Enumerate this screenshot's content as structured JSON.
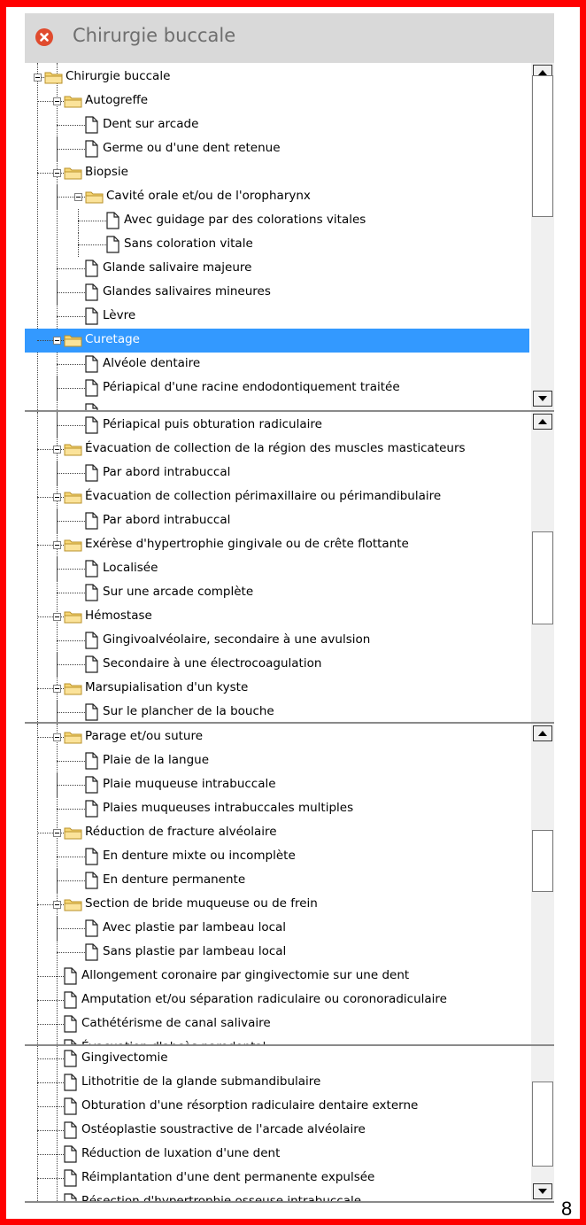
{
  "window": {
    "title": "Chirurgie buccale",
    "close_icon": "close-icon"
  },
  "colors": {
    "border": "#ff0000",
    "selection": "#3399ff",
    "close": "#e04b2e",
    "titlebar": "#d9d9d9"
  },
  "panes": [
    {
      "rows": [
        {
          "label": "Chirurgie buccale",
          "level": 0,
          "type": "folder",
          "expander": true
        },
        {
          "label": "Autogreffe",
          "level": 1,
          "type": "folder",
          "expander": true
        },
        {
          "label": "Dent sur arcade",
          "level": 2,
          "type": "doc"
        },
        {
          "label": "Germe ou d'une dent retenue",
          "level": 2,
          "type": "doc"
        },
        {
          "label": "Biopsie",
          "level": 1,
          "type": "folder",
          "expander": true
        },
        {
          "label": "Cavité orale et/ou de l'oropharynx",
          "level": 2,
          "type": "folder",
          "expander": true
        },
        {
          "label": "Avec guidage par des colorations vitales",
          "level": 3,
          "type": "doc"
        },
        {
          "label": "Sans coloration vitale",
          "level": 3,
          "type": "doc"
        },
        {
          "label": "Glande salivaire majeure",
          "level": 2,
          "type": "doc"
        },
        {
          "label": "Glandes salivaires mineures",
          "level": 2,
          "type": "doc"
        },
        {
          "label": "Lèvre",
          "level": 2,
          "type": "doc"
        },
        {
          "label": "Curetage",
          "level": 1,
          "type": "folder",
          "expander": true,
          "selected": true
        },
        {
          "label": "Alvéole dentaire",
          "level": 2,
          "type": "doc"
        },
        {
          "label": "Périapical d'une racine endodontiquement traitée",
          "level": 2,
          "type": "doc"
        },
        {
          "label": "",
          "level": 2,
          "type": "doc"
        }
      ]
    },
    {
      "rows": [
        {
          "label": "Périapical puis obturation radiculaire",
          "level": 2,
          "type": "doc"
        },
        {
          "label": "Évacuation de collection de la région des muscles masticateurs",
          "level": 1,
          "type": "folder",
          "expander": true
        },
        {
          "label": "Par abord intrabuccal",
          "level": 2,
          "type": "doc"
        },
        {
          "label": "Évacuation de collection périmaxillaire ou périmandibulaire",
          "level": 1,
          "type": "folder",
          "expander": true
        },
        {
          "label": "Par abord intrabuccal",
          "level": 2,
          "type": "doc"
        },
        {
          "label": "Exérèse d'hypertrophie gingivale ou de crête flottante",
          "level": 1,
          "type": "folder",
          "expander": true
        },
        {
          "label": "Localisée",
          "level": 2,
          "type": "doc"
        },
        {
          "label": "Sur une arcade complète",
          "level": 2,
          "type": "doc"
        },
        {
          "label": "Hémostase",
          "level": 1,
          "type": "folder",
          "expander": true
        },
        {
          "label": "Gingivoalvéolaire, secondaire à une avulsion",
          "level": 2,
          "type": "doc"
        },
        {
          "label": "Secondaire à une électrocoagulation",
          "level": 2,
          "type": "doc"
        },
        {
          "label": "Marsupialisation d'un kyste",
          "level": 1,
          "type": "folder",
          "expander": true
        },
        {
          "label": "Sur le plancher de la bouche",
          "level": 2,
          "type": "doc"
        }
      ]
    },
    {
      "rows": [
        {
          "label": "Parage et/ou suture",
          "level": 1,
          "type": "folder",
          "expander": true
        },
        {
          "label": "Plaie de la langue",
          "level": 2,
          "type": "doc"
        },
        {
          "label": "Plaie muqueuse intrabuccale",
          "level": 2,
          "type": "doc"
        },
        {
          "label": "Plaies muqueuses intrabuccales multiples",
          "level": 2,
          "type": "doc"
        },
        {
          "label": "Réduction de fracture alvéolaire",
          "level": 1,
          "type": "folder",
          "expander": true
        },
        {
          "label": "En denture mixte ou incomplète",
          "level": 2,
          "type": "doc"
        },
        {
          "label": "En denture permanente",
          "level": 2,
          "type": "doc"
        },
        {
          "label": "Section de bride muqueuse ou de frein",
          "level": 1,
          "type": "folder",
          "expander": true
        },
        {
          "label": "Avec plastie par lambeau local",
          "level": 2,
          "type": "doc"
        },
        {
          "label": "Sans plastie par lambeau local",
          "level": 2,
          "type": "doc"
        },
        {
          "label": "Allongement coronaire par gingivectomie sur une dent",
          "level": 1,
          "type": "doc"
        },
        {
          "label": "Amputation et/ou séparation radiculaire ou coronoradiculaire",
          "level": 1,
          "type": "doc"
        },
        {
          "label": "Cathétérisme de canal salivaire",
          "level": 1,
          "type": "doc"
        },
        {
          "label": "Évacuation d'abcès parodontal",
          "level": 1,
          "type": "doc"
        }
      ]
    },
    {
      "rows": [
        {
          "label": "Gingivectomie",
          "level": 1,
          "type": "doc"
        },
        {
          "label": "Lithotritie de la glande submandibulaire",
          "level": 1,
          "type": "doc"
        },
        {
          "label": "Obturation d'une résorption radiculaire dentaire externe",
          "level": 1,
          "type": "doc"
        },
        {
          "label": "Ostéoplastie soustractive de l'arcade alvéolaire",
          "level": 1,
          "type": "doc"
        },
        {
          "label": "Réduction de luxation d'une dent",
          "level": 1,
          "type": "doc"
        },
        {
          "label": "Réimplantation d'une dent permanente expulsée",
          "level": 1,
          "type": "doc"
        },
        {
          "label": "Résection d'hypertrophie osseuse intrabuccale",
          "level": 1,
          "type": "doc"
        }
      ]
    }
  ],
  "page_number": "8"
}
